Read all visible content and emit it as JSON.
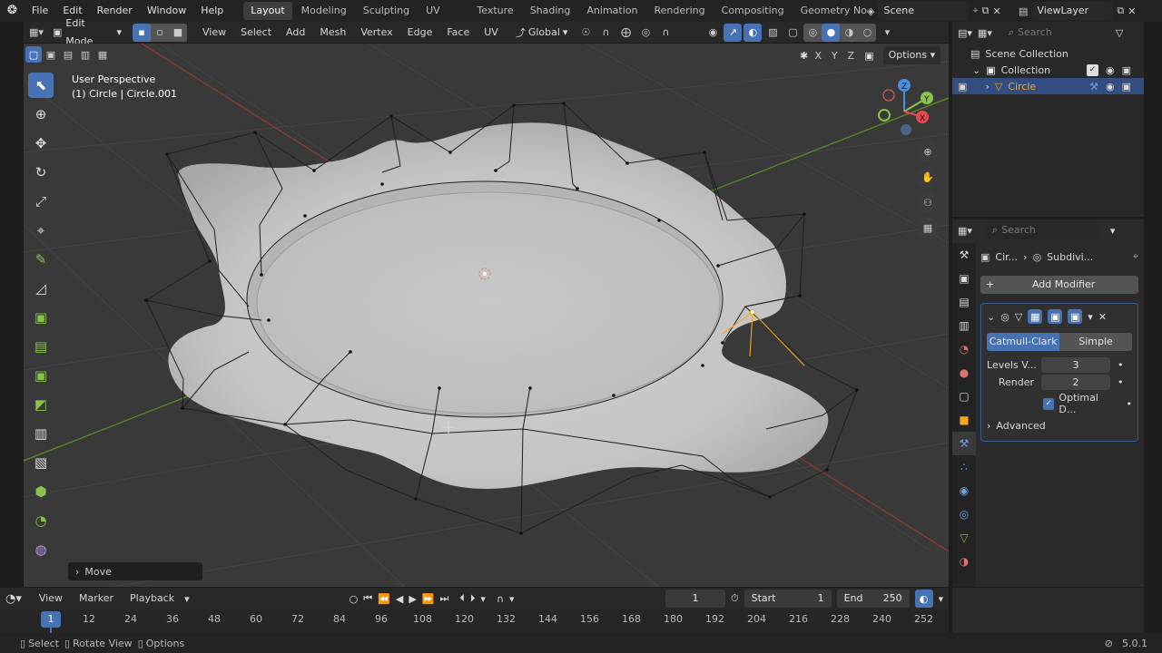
{
  "topbar": {
    "menus": [
      "File",
      "Edit",
      "Render",
      "Window",
      "Help"
    ],
    "workspaces": [
      "Layout",
      "Modeling",
      "Sculpting",
      "UV Editing",
      "Texture Paint",
      "Shading",
      "Animation",
      "Rendering",
      "Compositing",
      "Geometry Nodes"
    ],
    "active_workspace": "Layout",
    "scene": "Scene",
    "view_layer": "ViewLayer"
  },
  "viewport_header": {
    "mode": "Edit Mode",
    "menus": [
      "View",
      "Select",
      "Add",
      "Mesh",
      "Vertex",
      "Edge",
      "Face",
      "UV"
    ],
    "orientation": "Global",
    "options_label": "Options",
    "axes": [
      "X",
      "Y",
      "Z"
    ]
  },
  "viewport": {
    "perspective": "User Perspective",
    "object_info": "(1) Circle | Circle.001",
    "last_operator": "Move",
    "gizmo_axes": {
      "x": "X",
      "y": "Y",
      "z": "Z"
    }
  },
  "outliner": {
    "search_placeholder": "Search",
    "scene_collection": "Scene Collection",
    "collection": "Collection",
    "object": "Circle"
  },
  "properties": {
    "search_placeholder": "Search",
    "breadcrumb_object": "Cir...",
    "breadcrumb_modifier": "Subdivi...",
    "add_modifier": "Add Modifier",
    "tabs": [
      "Catmull-Clark",
      "Simple"
    ],
    "active_tab": "Catmull-Clark",
    "levels_label": "Levels V...",
    "levels_value": "3",
    "render_label": "Render",
    "render_value": "2",
    "optimal_label": "Optimal D...",
    "advanced_label": "Advanced"
  },
  "timeline": {
    "menus": [
      "View",
      "Marker",
      "Playback"
    ],
    "current_frame": "1",
    "start_label": "Start",
    "start_value": "1",
    "end_label": "End",
    "end_value": "250",
    "ruler": [
      "1",
      "12",
      "24",
      "36",
      "48",
      "60",
      "72",
      "84",
      "96",
      "108",
      "120",
      "132",
      "144",
      "156",
      "168",
      "180",
      "192",
      "204",
      "216",
      "228",
      "240",
      "252"
    ]
  },
  "statusbar": {
    "select": "Select",
    "rotate": "Rotate View",
    "options": "Options",
    "version": "5.0.1"
  },
  "colors": {
    "accent": "#4772b3",
    "selected_object": "#f5a623",
    "axis_x": "#e8474f",
    "axis_y": "#8bc34a",
    "axis_z": "#4a90e2"
  }
}
